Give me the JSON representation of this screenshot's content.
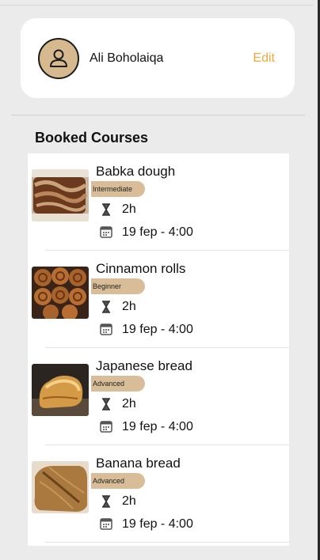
{
  "profile": {
    "name": "Ali Boholaiqa",
    "edit_label": "Edit",
    "avatar_icon": "person-icon"
  },
  "section": {
    "title": "Booked Courses"
  },
  "courses": [
    {
      "title": "Babka dough",
      "level": "Intermediate",
      "duration": "2h",
      "date": "19 fep - 4:00",
      "image": "babka-photo"
    },
    {
      "title": "Cinnamon rolls",
      "level": "Beginner",
      "duration": "2h",
      "date": "19 fep - 4:00",
      "image": "cinnamon-rolls-photo"
    },
    {
      "title": "Japanese bread",
      "level": "Advanced",
      "duration": "2h",
      "date": "19 fep - 4:00",
      "image": "japanese-bread-photo"
    },
    {
      "title": "Banana bread",
      "level": "Advanced",
      "duration": "2h",
      "date": "19 fep - 4:00",
      "image": "banana-bread-photo"
    }
  ],
  "colors": {
    "accent": "#f0a83a",
    "badge": "#d9bd98",
    "background": "#ebebeb"
  }
}
